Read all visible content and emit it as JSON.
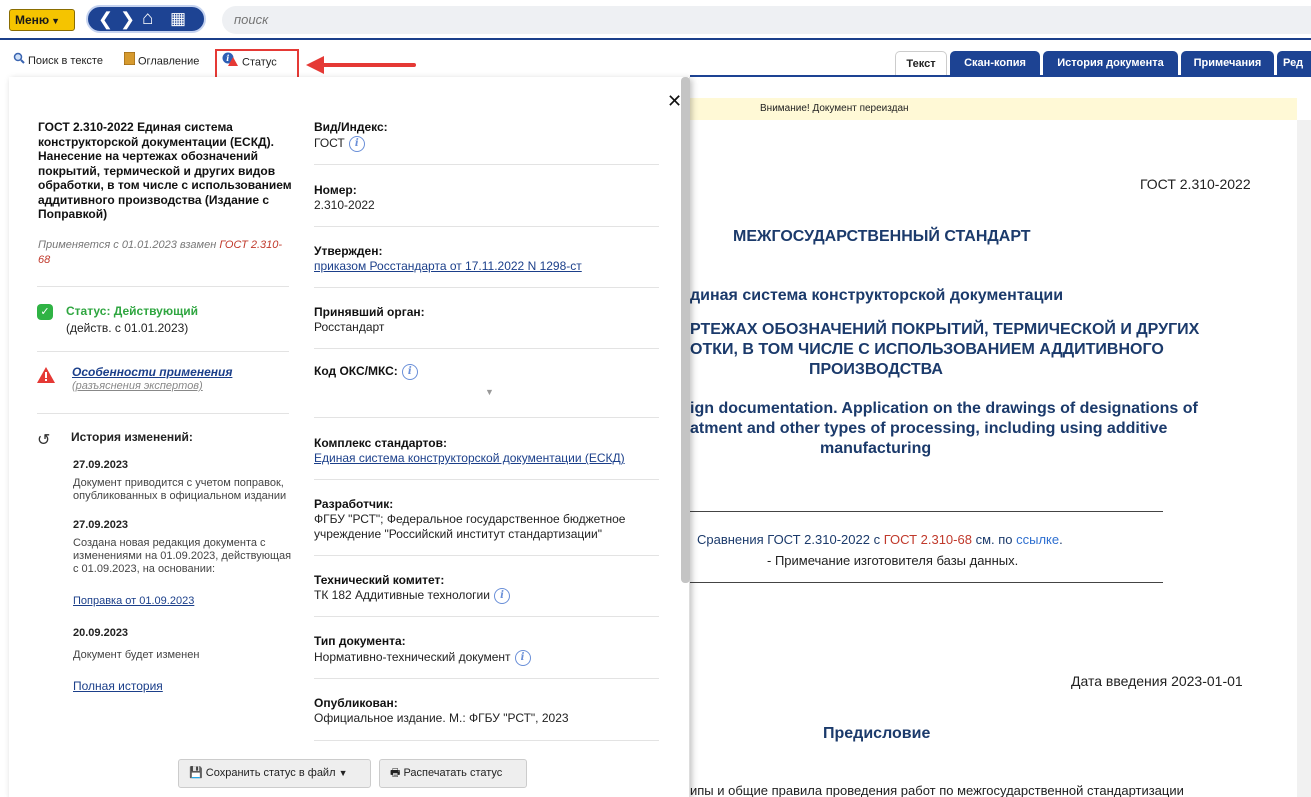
{
  "topbar": {
    "menu_label": "Меню",
    "search_placeholder": "поиск"
  },
  "toolbar": {
    "search_in_text": "Поиск в тексте",
    "contents": "Оглавление",
    "status": "Статус"
  },
  "tabs": [
    "Текст",
    "Скан-копия",
    "История документа",
    "Примечания",
    "Ред"
  ],
  "warning": "Внимание! Документ переиздан",
  "panel": {
    "title": "ГОСТ 2.310-2022 Единая система конструкторской документации (ЕСКД). Нанесение на чертежах обозначений покрытий, термической и других видов обработки, в том числе с использованием аддитивного производства (Издание с Поправкой)",
    "applies_prefix": "Применяется с 01.01.2023 взамен ",
    "applies_link": "ГОСТ 2.310-68",
    "status_title": "Статус: Действующий",
    "status_sub": "(действ. с 01.01.2023)",
    "features_link": "Особенности применения",
    "features_sub": "(разъяснения экспертов)",
    "history_title": "История изменений:",
    "history": [
      {
        "date": "27.09.2023",
        "text": "Документ приводится с учетом поправок, опубликованных в официальном издании"
      },
      {
        "date": "27.09.2023",
        "text": "Создана новая редакция документа с изменениями на 01.09.2023, действующая с 01.09.2023, на основании:",
        "link": "Поправка от 01.09.2023"
      },
      {
        "date": "20.09.2023",
        "text": "Документ будет изменен"
      }
    ],
    "full_history": "Полная история",
    "fields": {
      "type_label": "Вид/Индекс:",
      "type_value": "ГОСТ",
      "number_label": "Номер:",
      "number_value": "2.310-2022",
      "approved_label": "Утвержден:",
      "approved_value": "приказом Росстандарта от 17.11.2022 N 1298-ст",
      "body_label": "Принявший орган:",
      "body_value": "Росстандарт",
      "oks_label": "Код ОКС/МКС:",
      "complex_label": "Комплекс стандартов:",
      "complex_value": "Единая система конструкторской документации (ЕСКД)",
      "developer_label": "Разработчик:",
      "developer_value_1": "ФГБУ \"РСТ\"; Федеральное государственное бюджетное",
      "developer_value_2": "учреждение \"Российский институт стандартизации\"",
      "committee_label": "Технический комитет:",
      "committee_value": "ТК 182 Аддитивные технологии",
      "doctype_label": "Тип документа:",
      "doctype_value": "Нормативно-технический документ",
      "published_label": "Опубликован:",
      "published_value": "Официальное издание. М.: ФГБУ \"РСТ\", 2023"
    },
    "save_button": "Сохранить статус в файл",
    "print_button": "Распечатать статус"
  },
  "doc": {
    "code": "ГОСТ 2.310-2022",
    "header": "МЕЖГОСУДАРСТВЕННЫЙ СТАНДАРТ",
    "l1": "диная система конструкторской документации",
    "l2": "РТЕЖАХ ОБОЗНАЧЕНИЙ ПОКРЫТИЙ, ТЕРМИЧЕСКОЙ И ДРУГИХ",
    "l3": "ОТКИ, В ТОМ ЧИСЛЕ С ИСПОЛЬЗОВАНИЕМ АДДИТИВНОГО",
    "l4": "ПРОИЗВОДСТВА",
    "e1": "ign documentation. Application on the drawings of designations of",
    "e2": "atment and other types of processing, including using additive",
    "e3": "manufacturing",
    "cmp_pre": "Сравнения ГОСТ 2.310-2022 с ",
    "cmp_link": "ГОСТ 2.310-68",
    "cmp_mid": " см. по ",
    "cmp_link2": "ссылке",
    "cmp_end": ".",
    "note": "- Примечание изготовителя базы данных.",
    "date": "Дата введения 2023-01-01",
    "preface": "Предисловие",
    "bottom": "ипы и общие правила проведения работ по межгосударственной стандартизации"
  }
}
